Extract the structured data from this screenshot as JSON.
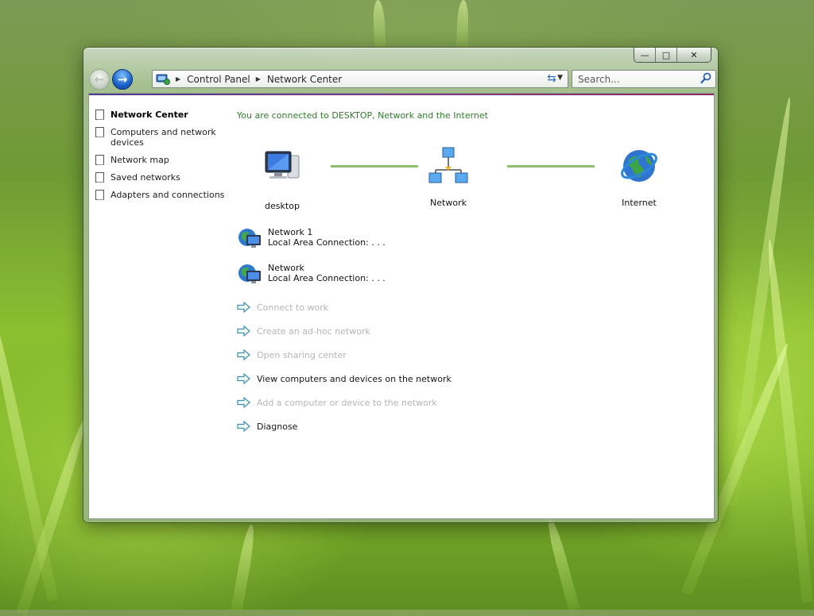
{
  "window": {
    "caption_buttons": {
      "minimize": "—",
      "maximize": "□",
      "close": "✕"
    }
  },
  "navbar": {
    "breadcrumbs": [
      "Control Panel",
      "Network Center"
    ],
    "search_placeholder": "Search..."
  },
  "sidebar": {
    "items": [
      {
        "label": "Network Center",
        "active": true
      },
      {
        "label": "Computers and network devices"
      },
      {
        "label": "Network map"
      },
      {
        "label": "Saved networks"
      },
      {
        "label": "Adapters and connections"
      }
    ]
  },
  "main": {
    "status": "You are connected to DESKTOP, Network and the Internet",
    "map": {
      "desktop_label": "desktop",
      "network_label": "Network",
      "internet_label": "Internet"
    },
    "connections": [
      {
        "name": "Network 1",
        "type": "Local Area Connection:",
        "detail": ". . ."
      },
      {
        "name": "Network",
        "type": "Local Area Connection:",
        "detail": ". . ."
      }
    ],
    "tasks": [
      {
        "label": "Connect to work",
        "enabled": false
      },
      {
        "label": "Create an ad-hoc network",
        "enabled": false
      },
      {
        "label": "Open sharing center",
        "enabled": false
      },
      {
        "label": "View computers and devices on the network",
        "enabled": true
      },
      {
        "label": "Add a computer or device to the network",
        "enabled": false
      },
      {
        "label": "Diagnose",
        "enabled": true
      }
    ]
  },
  "colors": {
    "status_text": "#2f7a2c",
    "link_line": "#8cbf6e",
    "disabled_text": "#b5b5b5",
    "accent_blue": "#1c62c9"
  }
}
